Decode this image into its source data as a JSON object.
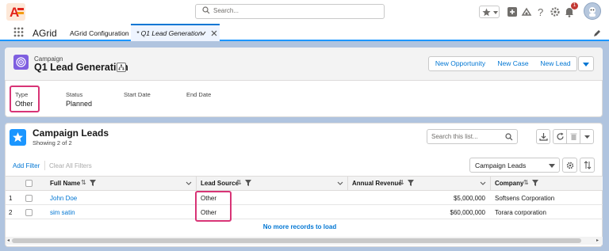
{
  "header": {
    "search_placeholder": "Search...",
    "notification_count": "1"
  },
  "nav": {
    "app_name": "AGrid",
    "tab1": "AGrid Configuration",
    "tab2": "* Q1 Lead Generation"
  },
  "record": {
    "object_label": "Campaign",
    "title": "Q1 Lead Generation",
    "buttons": [
      "New Opportunity",
      "New Case",
      "New Lead"
    ],
    "fields": [
      {
        "label": "Type",
        "value": "Other"
      },
      {
        "label": "Status",
        "value": "Planned"
      },
      {
        "label": "Start Date",
        "value": ""
      },
      {
        "label": "End Date",
        "value": ""
      }
    ]
  },
  "related": {
    "title": "Campaign Leads",
    "subtitle": "Showing 2 of 2",
    "search_placeholder": "Search this list...",
    "add_filter": "Add Filter",
    "clear_filters": "Clear All Filters",
    "list_view": "Campaign Leads",
    "columns": [
      "Full Name",
      "Lead Source",
      "Annual Revenue",
      "Company"
    ],
    "rows": [
      {
        "num": "1",
        "name": "John Doe",
        "source": "Other",
        "revenue": "$5,000,000",
        "company": "Softsens Corporation"
      },
      {
        "num": "2",
        "name": "sim satin",
        "source": "Other",
        "revenue": "$60,000,000",
        "company": "Torara corporation"
      }
    ],
    "footer": "No more records to load"
  },
  "colors": {
    "brand": "#0176d3",
    "highlight": "#d83476"
  }
}
